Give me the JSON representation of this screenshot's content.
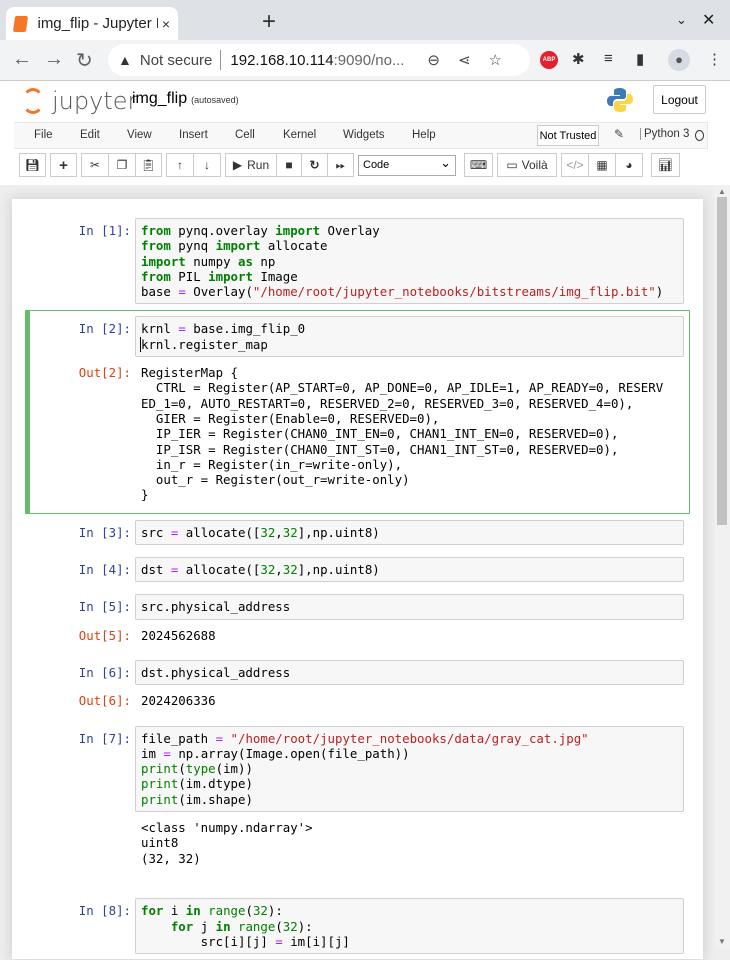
{
  "browser": {
    "tab_title": "img_flip - Jupyter Notebook",
    "new_tab": "+",
    "close_tab": "×",
    "url_security": "Not secure",
    "url_host": "192.168.10.114",
    "url_rest": ":9090/no...",
    "abp": "ABP"
  },
  "header": {
    "logo_text": "jupyter",
    "notebook_name": "img_flip",
    "autosave": "(autosaved)",
    "logout": "Logout"
  },
  "menu": {
    "items": [
      "File",
      "Edit",
      "View",
      "Insert",
      "Cell",
      "Kernel",
      "Widgets",
      "Help"
    ],
    "trusted": "Not Trusted",
    "kernel": "Python 3"
  },
  "toolbar": {
    "run": "Run",
    "cell_type": "Code",
    "voila": "Voilà"
  },
  "cells": [
    {
      "prompt": "In [1]:",
      "lines": [
        [
          [
            "from",
            "k"
          ],
          [
            " pynq.overlay ",
            ""
          ],
          [
            "import",
            "k"
          ],
          [
            " Overlay",
            ""
          ]
        ],
        [
          [
            "from",
            "k"
          ],
          [
            " pynq ",
            ""
          ],
          [
            "import",
            "k"
          ],
          [
            " allocate",
            ""
          ]
        ],
        [
          [
            "import",
            "k"
          ],
          [
            " numpy ",
            ""
          ],
          [
            "as",
            "k"
          ],
          [
            " np",
            ""
          ]
        ],
        [
          [
            "from",
            "k"
          ],
          [
            " PIL ",
            ""
          ],
          [
            "import",
            "k"
          ],
          [
            " Image",
            ""
          ]
        ],
        [
          [
            "base ",
            ""
          ],
          [
            "=",
            "o"
          ],
          [
            " Overlay(",
            ""
          ],
          [
            "\"/home/root/jupyter_notebooks/bitstreams/img_flip.bit\"",
            "s"
          ],
          [
            ")",
            ""
          ]
        ]
      ]
    },
    {
      "prompt": "In [2]:",
      "selected": true,
      "lines": [
        [
          [
            "krnl ",
            ""
          ],
          [
            "=",
            "o"
          ],
          [
            " base.img_flip_0",
            ""
          ]
        ],
        [
          [
            "k",
            "caret"
          ],
          [
            "rnl.register_map",
            ""
          ]
        ]
      ],
      "out_prompt": "Out[2]:",
      "output": "RegisterMap {\n  CTRL = Register(AP_START=0, AP_DONE=0, AP_IDLE=1, AP_READY=0, RESERV\nED_1=0, AUTO_RESTART=0, RESERVED_2=0, RESERVED_3=0, RESERVED_4=0),\n  GIER = Register(Enable=0, RESERVED=0),\n  IP_IER = Register(CHAN0_INT_EN=0, CHAN1_INT_EN=0, RESERVED=0),\n  IP_ISR = Register(CHAN0_INT_ST=0, CHAN1_INT_ST=0, RESERVED=0),\n  in_r = Register(in_r=write-only),\n  out_r = Register(out_r=write-only)\n}"
    },
    {
      "prompt": "In [3]:",
      "lines": [
        [
          [
            "src ",
            ""
          ],
          [
            "=",
            "o"
          ],
          [
            " allocate([",
            ""
          ],
          [
            "32",
            "n"
          ],
          [
            ",",
            ""
          ],
          [
            "32",
            "n"
          ],
          [
            "],np.uint8)",
            ""
          ]
        ]
      ]
    },
    {
      "prompt": "In [4]:",
      "lines": [
        [
          [
            "dst ",
            ""
          ],
          [
            "=",
            "o"
          ],
          [
            " allocate([",
            ""
          ],
          [
            "32",
            "n"
          ],
          [
            ",",
            ""
          ],
          [
            "32",
            "n"
          ],
          [
            "],np.uint8)",
            ""
          ]
        ]
      ]
    },
    {
      "prompt": "In [5]:",
      "lines": [
        [
          [
            "src.physical_address",
            ""
          ]
        ]
      ],
      "out_prompt": "Out[5]:",
      "output": "2024562688"
    },
    {
      "prompt": "In [6]:",
      "lines": [
        [
          [
            "dst.physical_address",
            ""
          ]
        ]
      ],
      "out_prompt": "Out[6]:",
      "output": "2024206336"
    },
    {
      "prompt": "In [7]:",
      "lines": [
        [
          [
            "file_path ",
            ""
          ],
          [
            "=",
            "o"
          ],
          [
            " ",
            ""
          ],
          [
            "\"/home/root/jupyter_notebooks/data/gray_cat.jpg\"",
            "s"
          ]
        ],
        [
          [
            "im ",
            ""
          ],
          [
            "=",
            "o"
          ],
          [
            " np.array(Image.open(file_path))",
            ""
          ]
        ],
        [
          [
            "print",
            "b"
          ],
          [
            "(",
            ""
          ],
          [
            "type",
            "b"
          ],
          [
            "(im))",
            ""
          ]
        ],
        [
          [
            "print",
            "b"
          ],
          [
            "(im.dtype)",
            ""
          ]
        ],
        [
          [
            "print",
            "b"
          ],
          [
            "(im.shape)",
            ""
          ]
        ]
      ],
      "out_prompt": "",
      "output": "<class 'numpy.ndarray'>\nuint8\n(32, 32)\n "
    },
    {
      "prompt": "In [8]:",
      "lines": [
        [
          [
            "for",
            "k"
          ],
          [
            " i ",
            ""
          ],
          [
            "in",
            "k"
          ],
          [
            " ",
            ""
          ],
          [
            "range",
            "b"
          ],
          [
            "(",
            ""
          ],
          [
            "32",
            "n"
          ],
          [
            "):",
            ""
          ]
        ],
        [
          [
            "    ",
            ""
          ],
          [
            "for",
            "k"
          ],
          [
            " j ",
            ""
          ],
          [
            "in",
            "k"
          ],
          [
            " ",
            ""
          ],
          [
            "range",
            "b"
          ],
          [
            "(",
            ""
          ],
          [
            "32",
            "n"
          ],
          [
            "):",
            ""
          ]
        ],
        [
          [
            "        src[i][j] ",
            ""
          ],
          [
            "=",
            "o"
          ],
          [
            " im[i][j]",
            ""
          ]
        ]
      ]
    }
  ]
}
